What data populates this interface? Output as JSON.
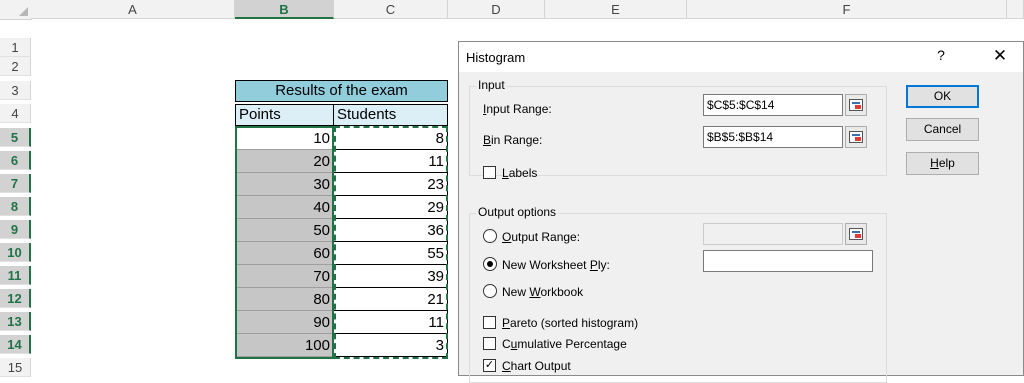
{
  "sheet": {
    "columns": [
      "A",
      "B",
      "C",
      "D",
      "E",
      "F"
    ],
    "rows": [
      "1",
      "2",
      "3",
      "4",
      "5",
      "6",
      "7",
      "8",
      "9",
      "10",
      "11",
      "12",
      "13",
      "14",
      "15"
    ],
    "table": {
      "title": "Results of the exam",
      "col1_header": "Points",
      "col2_header": "Students",
      "points": [
        "10",
        "20",
        "30",
        "40",
        "50",
        "60",
        "70",
        "80",
        "90",
        "100"
      ],
      "students": [
        "8",
        "11",
        "23",
        "29",
        "36",
        "55",
        "39",
        "21",
        "11",
        "3"
      ]
    },
    "colors": {
      "title_fill": "#92cddc",
      "header_fill": "#ddeff6",
      "selection": "#217346",
      "shaded": "#c6c6c6"
    }
  },
  "dialog": {
    "title": "Histogram",
    "help_glyph": "?",
    "close_glyph": "✕",
    "input_group": {
      "legend": "Input",
      "input_range_label_u": "I",
      "input_range_label_rest": "nput Range:",
      "input_range_value": "$C$5:$C$14",
      "bin_range_label_u": "B",
      "bin_range_label_rest": "in Range:",
      "bin_range_value": "$B$5:$B$14",
      "labels_label_u": "L",
      "labels_label_rest": "abels",
      "labels_checked": false
    },
    "output_group": {
      "legend": "Output options",
      "output_range_label_u": "O",
      "output_range_label_rest": "utput Range:",
      "output_range_value": "",
      "new_ply_label_pre": "New Worksheet ",
      "new_ply_label_u": "P",
      "new_ply_label_rest": "ly:",
      "new_ply_value": "",
      "new_workbook_label_pre": "New ",
      "new_workbook_label_u": "W",
      "new_workbook_label_rest": "orkbook",
      "selected_option": "New Worksheet Ply",
      "pareto_label_u": "P",
      "pareto_label_rest": "areto (sorted histogram)",
      "pareto_checked": false,
      "cumulative_label_pre": "C",
      "cumulative_label_u": "u",
      "cumulative_label_rest": "mulative Percentage",
      "cumulative_checked": false,
      "chart_label_u": "C",
      "chart_label_rest": "hart Output",
      "chart_checked": true,
      "check_glyph": "✓"
    },
    "buttons": {
      "ok": "OK",
      "cancel": "Cancel",
      "help_u": "H",
      "help_rest": "elp"
    }
  }
}
